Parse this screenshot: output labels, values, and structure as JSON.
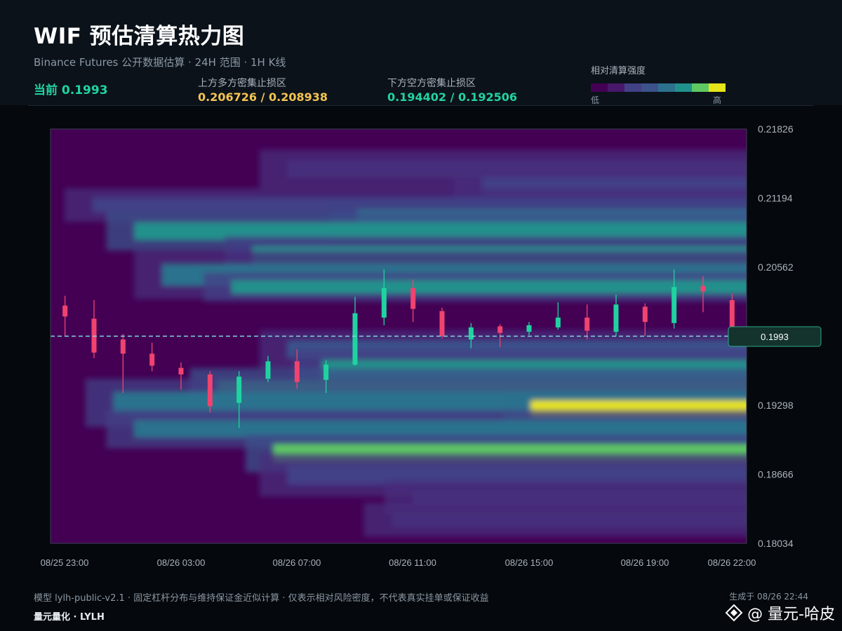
{
  "header": {
    "title": "WIF 预估清算热力图",
    "subtitle": "Binance Futures 公开数据估算 · 24H 范围 · 1H K线",
    "current_label": "当前",
    "current_value": "0.1993",
    "upper_label": "上方多方密集止损区",
    "upper_value": "0.206726 / 0.208938",
    "lower_label": "下方空方密集止损区",
    "lower_value": "0.194402 / 0.192506",
    "legend_title": "相对清算强度",
    "legend_low": "低",
    "legend_high": "高"
  },
  "colors": {
    "upper_value": "#f5c451",
    "lower_value": "#21d4a0",
    "up_candle": "#1fd3a0",
    "down_candle": "#f0436f",
    "price_line": "#7fd6df",
    "legend_scale": [
      "#440154",
      "#48186a",
      "#472d7b",
      "#424086",
      "#3b528b",
      "#2c728e",
      "#21918c",
      "#28ae80",
      "#5ec962",
      "#e7e419"
    ]
  },
  "chart_data": {
    "type": "heatmap",
    "title": "WIF 预估清算热力图",
    "xlabel": "",
    "ylabel": "",
    "ylim": [
      0.18034,
      0.21826
    ],
    "x_tick_labels": [
      "08/25 23:00",
      "08/26 03:00",
      "08/26 07:00",
      "08/26 11:00",
      "08/26 15:00",
      "08/26 19:00",
      "08/26 22:00"
    ],
    "y_tick_labels": [
      "0.21826",
      "0.21194",
      "0.20562",
      "0.19930",
      "0.19298",
      "0.18666",
      "0.18034"
    ],
    "current_price": 0.1993,
    "current_price_label": "0.1993",
    "candles": [
      {
        "open": 0.2021,
        "high": 0.203,
        "low": 0.1993,
        "close": 0.2011
      },
      {
        "open": 0.2009,
        "high": 0.2026,
        "low": 0.1973,
        "close": 0.1978
      },
      {
        "open": 0.199,
        "high": 0.1995,
        "low": 0.1941,
        "close": 0.1977
      },
      {
        "open": 0.1977,
        "high": 0.1987,
        "low": 0.1961,
        "close": 0.1966
      },
      {
        "open": 0.1964,
        "high": 0.1969,
        "low": 0.1944,
        "close": 0.1958
      },
      {
        "open": 0.1958,
        "high": 0.1961,
        "low": 0.1923,
        "close": 0.1929
      },
      {
        "open": 0.1932,
        "high": 0.1961,
        "low": 0.1909,
        "close": 0.1956
      },
      {
        "open": 0.1954,
        "high": 0.1975,
        "low": 0.1951,
        "close": 0.197
      },
      {
        "open": 0.197,
        "high": 0.1981,
        "low": 0.1945,
        "close": 0.1951
      },
      {
        "open": 0.1953,
        "high": 0.1971,
        "low": 0.1941,
        "close": 0.1967
      },
      {
        "open": 0.1967,
        "high": 0.2029,
        "low": 0.1966,
        "close": 0.2014
      },
      {
        "open": 0.201,
        "high": 0.2054,
        "low": 0.2003,
        "close": 0.2037
      },
      {
        "open": 0.2037,
        "high": 0.2045,
        "low": 0.2006,
        "close": 0.2018
      },
      {
        "open": 0.2016,
        "high": 0.2019,
        "low": 0.1991,
        "close": 0.1993
      },
      {
        "open": 0.199,
        "high": 0.2005,
        "low": 0.1982,
        "close": 0.2001
      },
      {
        "open": 0.2002,
        "high": 0.2004,
        "low": 0.1983,
        "close": 0.1996
      },
      {
        "open": 0.1997,
        "high": 0.2006,
        "low": 0.1994,
        "close": 0.2003
      },
      {
        "open": 0.2001,
        "high": 0.2024,
        "low": 0.1999,
        "close": 0.201
      },
      {
        "open": 0.201,
        "high": 0.2022,
        "low": 0.199,
        "close": 0.1998
      },
      {
        "open": 0.1997,
        "high": 0.2031,
        "low": 0.1993,
        "close": 0.2022
      },
      {
        "open": 0.202,
        "high": 0.2023,
        "low": 0.1993,
        "close": 0.2006
      },
      {
        "open": 0.2005,
        "high": 0.2054,
        "low": 0.2,
        "close": 0.2038
      },
      {
        "open": 0.2039,
        "high": 0.2048,
        "low": 0.2015,
        "close": 0.2034
      },
      {
        "open": 0.2026,
        "high": 0.2032,
        "low": 0.1993,
        "close": 0.1993
      }
    ],
    "liquidation_bands": [
      {
        "price": 0.2146,
        "start": 0.3,
        "end": 1.0,
        "intensity": 0.22,
        "width": 0.0008
      },
      {
        "price": 0.213,
        "start": 0.58,
        "end": 1.0,
        "intensity": 0.35,
        "width": 0.0008
      },
      {
        "price": 0.2113,
        "start": 0.02,
        "end": 1.0,
        "intensity": 0.3,
        "width": 0.0007
      },
      {
        "price": 0.21,
        "start": 0.4,
        "end": 1.0,
        "intensity": 0.55,
        "width": 0.0009
      },
      {
        "price": 0.2089,
        "start": 0.08,
        "end": 1.0,
        "intensity": 0.72,
        "width": 0.0008
      },
      {
        "price": 0.2067,
        "start": 0.25,
        "end": 1.0,
        "intensity": 0.62,
        "width": 0.0008
      },
      {
        "price": 0.2049,
        "start": 0.12,
        "end": 0.52,
        "intensity": 0.5,
        "width": 0.001
      },
      {
        "price": 0.2038,
        "start": 0.22,
        "end": 0.46,
        "intensity": 0.68,
        "width": 0.0006
      },
      {
        "price": 0.1981,
        "start": 0.3,
        "end": 1.0,
        "intensity": 0.4,
        "width": 0.0008
      },
      {
        "price": 0.1962,
        "start": 0.35,
        "end": 1.0,
        "intensity": 0.62,
        "width": 0.0009
      },
      {
        "price": 0.1944,
        "start": 0.2,
        "end": 1.0,
        "intensity": 0.78,
        "width": 0.0009
      },
      {
        "price": 0.1932,
        "start": 0.05,
        "end": 1.0,
        "intensity": 0.6,
        "width": 0.001
      },
      {
        "price": 0.1927,
        "start": 0.65,
        "end": 1.0,
        "intensity": 0.98,
        "width": 0.0007
      },
      {
        "price": 0.1908,
        "start": 0.08,
        "end": 1.0,
        "intensity": 0.55,
        "width": 0.0008
      },
      {
        "price": 0.1886,
        "start": 0.28,
        "end": 1.0,
        "intensity": 0.9,
        "width": 0.0008
      },
      {
        "price": 0.1866,
        "start": 0.3,
        "end": 1.0,
        "intensity": 0.35,
        "width": 0.0009
      },
      {
        "price": 0.1845,
        "start": 0.48,
        "end": 1.0,
        "intensity": 0.25,
        "width": 0.0007
      },
      {
        "price": 0.1825,
        "start": 0.45,
        "end": 1.0,
        "intensity": 0.22,
        "width": 0.0007
      }
    ]
  },
  "footer": {
    "note": "模型 lylh-public-v2.1 · 固定杠杆分布与维持保证金近似计算 · 仅表示相对风险密度，不代表真实挂单或保证收益",
    "brand": "量元量化 · LYLH",
    "generated": "生成于 08/26 22:44",
    "watermark": "@ 量元-哈皮"
  }
}
